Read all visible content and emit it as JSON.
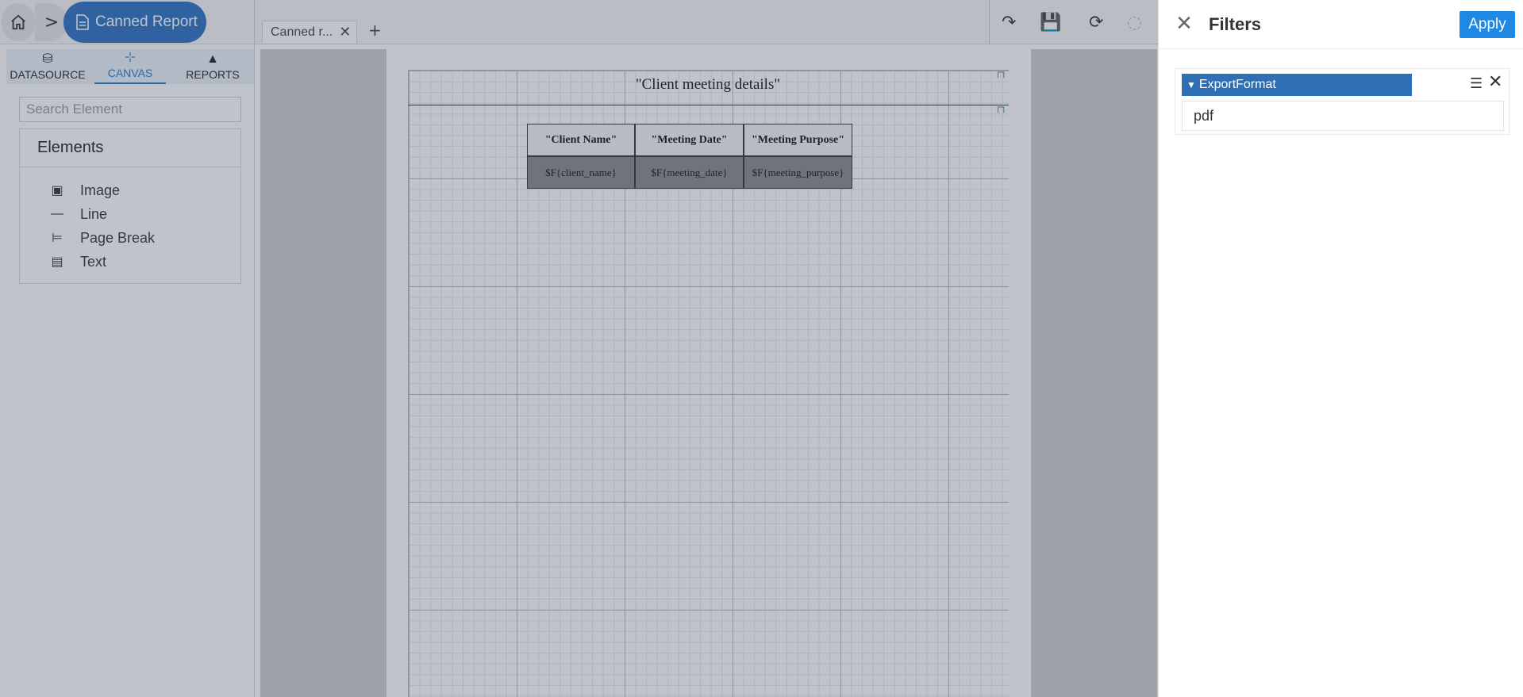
{
  "header": {
    "report_title": "Canned Report",
    "tab_label": "Canned r...",
    "add_tab": "+"
  },
  "left_panel": {
    "tabs": [
      {
        "label": "DATASOURCE",
        "icon": "database-icon"
      },
      {
        "label": "CANVAS",
        "icon": "canvas-icon"
      },
      {
        "label": "REPORTS",
        "icon": "chart-icon"
      }
    ],
    "search_placeholder": "Search Element",
    "elements_title": "Elements",
    "elements": [
      {
        "label": "Image",
        "icon": "image-icon"
      },
      {
        "label": "Line",
        "icon": "line-icon"
      },
      {
        "label": "Page Break",
        "icon": "page-break-icon"
      },
      {
        "label": "Text",
        "icon": "text-icon"
      }
    ]
  },
  "canvas": {
    "title": "\"Client meeting details\"",
    "headers": [
      "\"Client Name\"",
      "\"Meeting Date\"",
      "\"Meeting Purpose\""
    ],
    "fields": [
      "$F{client_name}",
      "$F{meeting_date}",
      "$F{meeting_purpose}"
    ]
  },
  "filters": {
    "title": "Filters",
    "apply_label": "Apply",
    "filter": {
      "name": "ExportFormat",
      "value": "pdf"
    }
  }
}
